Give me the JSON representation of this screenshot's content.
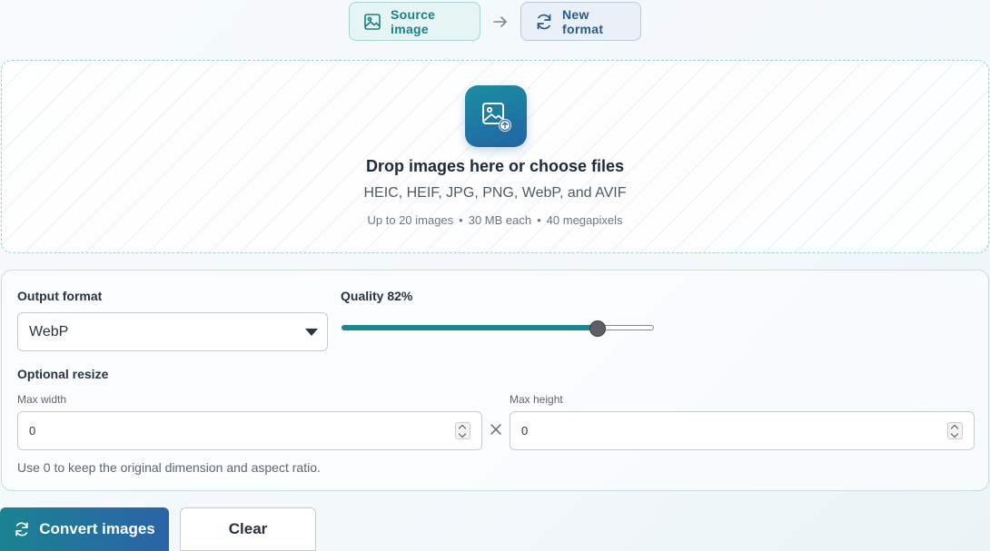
{
  "steps": {
    "source_label": "Source image",
    "target_label": "New format"
  },
  "dropzone": {
    "title": "Drop images here or choose files",
    "formats": "HEIC, HEIF, JPG, PNG, WebP, and AVIF",
    "limit_count": "Up to 20 images",
    "limit_size": "30 MB each",
    "limit_pixels": "40 megapixels"
  },
  "settings": {
    "output_format_label": "Output format",
    "output_format_value": "WebP",
    "quality_label": "Quality 82%",
    "quality_value": 82,
    "resize_label": "Optional resize",
    "max_width_label": "Max width",
    "max_width_value": "0",
    "max_height_label": "Max height",
    "max_height_value": "0",
    "hint": "Use 0 to keep the original dimension and aspect ratio."
  },
  "actions": {
    "convert_label": "Convert images",
    "clear_label": "Clear"
  },
  "colors": {
    "accent_teal": "#1b8791",
    "accent_blue": "#2a63a8"
  }
}
